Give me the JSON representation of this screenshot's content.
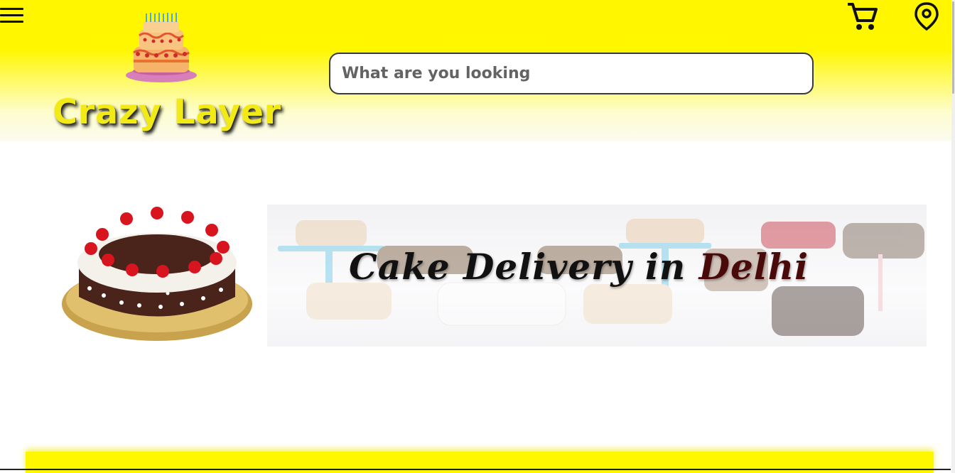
{
  "header": {
    "brand_name": "Crazy Layer",
    "search": {
      "placeholder": "What are you looking",
      "value": ""
    },
    "icons": [
      "menu-icon",
      "cake-logo",
      "cart-icon",
      "location-pin-icon"
    ],
    "background_color": "#fff700"
  },
  "banner": {
    "title_prefix": "Cake Delivery in ",
    "title_city": "Delhi"
  },
  "colors": {
    "brand_text": "#f2ea17",
    "accent_yellow": "#fff700",
    "city_text": "#4a0a0a"
  }
}
